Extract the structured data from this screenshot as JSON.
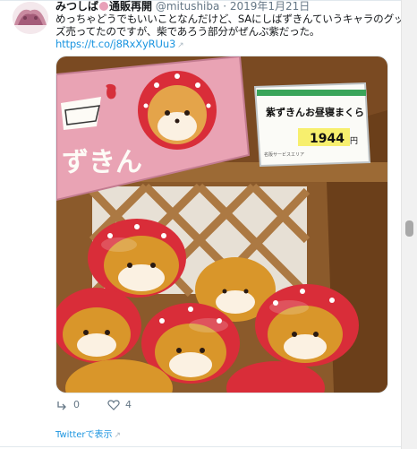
{
  "tweet": {
    "display_name": "みつしば",
    "name_suffix": "通販再開",
    "handle": "@mitushiba",
    "separator": "·",
    "date": "2019年1月21日",
    "text_line1": "めっちゃどうでもいいことなんだけど、SAにしばずきんていうキャラのグッ",
    "text_line2": "ズ売ってたのですが、柴であろう部分がぜんぶ紫だった。",
    "link": "https://t.co/j8RxXyRUu3",
    "link_icon": "external-link-icon"
  },
  "media": {
    "sign_line1": "紫ずきんお昼寝まくら",
    "price": "1944",
    "yen": "円",
    "sign_fine_print": "名阪サービスエリア",
    "poster_text": "ずきん",
    "colors": {
      "poster": "#e9a3b4",
      "plush_body": "#d9962a",
      "plush_hood": "#dc2f38",
      "shelf": "#8b5a2b"
    }
  },
  "actions": {
    "reply_count": "0",
    "like_count": "4",
    "reply_icon": "reply-icon",
    "like_icon": "heart-icon"
  },
  "footer": {
    "view_on_twitter": "Twitterで表示"
  }
}
